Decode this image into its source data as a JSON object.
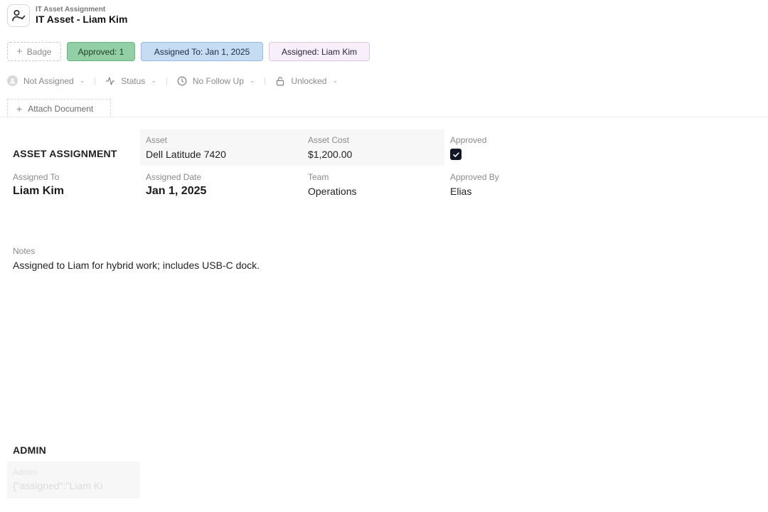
{
  "header": {
    "subtitle": "IT Asset Assignment",
    "title": "IT Asset - Liam Kim",
    "icon": "user-check-icon"
  },
  "badges": {
    "add_label": "Badge",
    "approved": "Approved: 1",
    "assigned_to": "Assigned To: Jan 1, 2025",
    "assigned": "Assigned: Liam Kim"
  },
  "toolbar": {
    "assignee": "Not Assigned",
    "status": "Status",
    "follow_up": "No Follow Up",
    "lock": "Unlocked"
  },
  "attach_label": "Attach Document",
  "asset_section": {
    "title": "ASSET ASSIGNMENT",
    "asset_label": "Asset",
    "asset_value": "Dell Latitude 7420",
    "cost_label": "Asset Cost",
    "cost_value": "$1,200.00",
    "approved_label": "Approved",
    "approved_checked": true,
    "assigned_to_label": "Assigned To",
    "assigned_to_value": "Liam Kim",
    "assigned_date_label": "Assigned Date",
    "assigned_date_value": "Jan 1, 2025",
    "team_label": "Team",
    "team_value": "Operations",
    "approved_by_label": "Approved By",
    "approved_by_value": "Elias",
    "notes_label": "Notes",
    "notes_value": "Assigned to Liam for hybrid work; includes USB-C dock."
  },
  "admin_section": {
    "title": "ADMIN",
    "field_label": "Admin",
    "field_value": "{\"assigned\":\"Liam Ki"
  },
  "colors": {
    "approved_badge": "#92cfa4",
    "assigned_to_badge": "#c6dcf2",
    "assigned_badge": "#f7f0fb",
    "checkbox": "#111827"
  }
}
